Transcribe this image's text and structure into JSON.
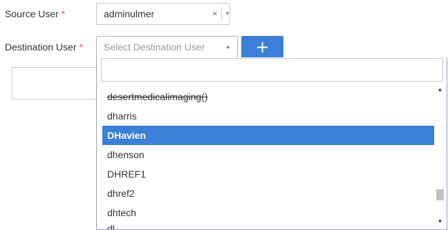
{
  "source_user": {
    "label": "Source User",
    "required_mark": "*",
    "value": "adminulmer",
    "clear_glyph": "×",
    "arrow_glyph": "▼"
  },
  "destination_user": {
    "label": "Destination User",
    "required_mark": "*",
    "placeholder": "Select Destination User",
    "arrow_glyph": "▲"
  },
  "add_button": {
    "label": "+"
  },
  "dropdown": {
    "search_value": "",
    "items": [
      {
        "label": "desertmedicalimaging()",
        "strikethrough": true
      },
      {
        "label": "dharris"
      },
      {
        "label": "DHavien",
        "selected": true
      },
      {
        "label": "dhenson"
      },
      {
        "label": "DHREF1"
      },
      {
        "label": "dhref2"
      },
      {
        "label": "dhtech"
      },
      {
        "label": "dl"
      }
    ],
    "scroll_up_glyph": "▲",
    "scroll_down_glyph": "▼",
    "scroll_position": 0.85
  },
  "colors": {
    "accent": "#3b80d8",
    "required": "#d9534f"
  }
}
